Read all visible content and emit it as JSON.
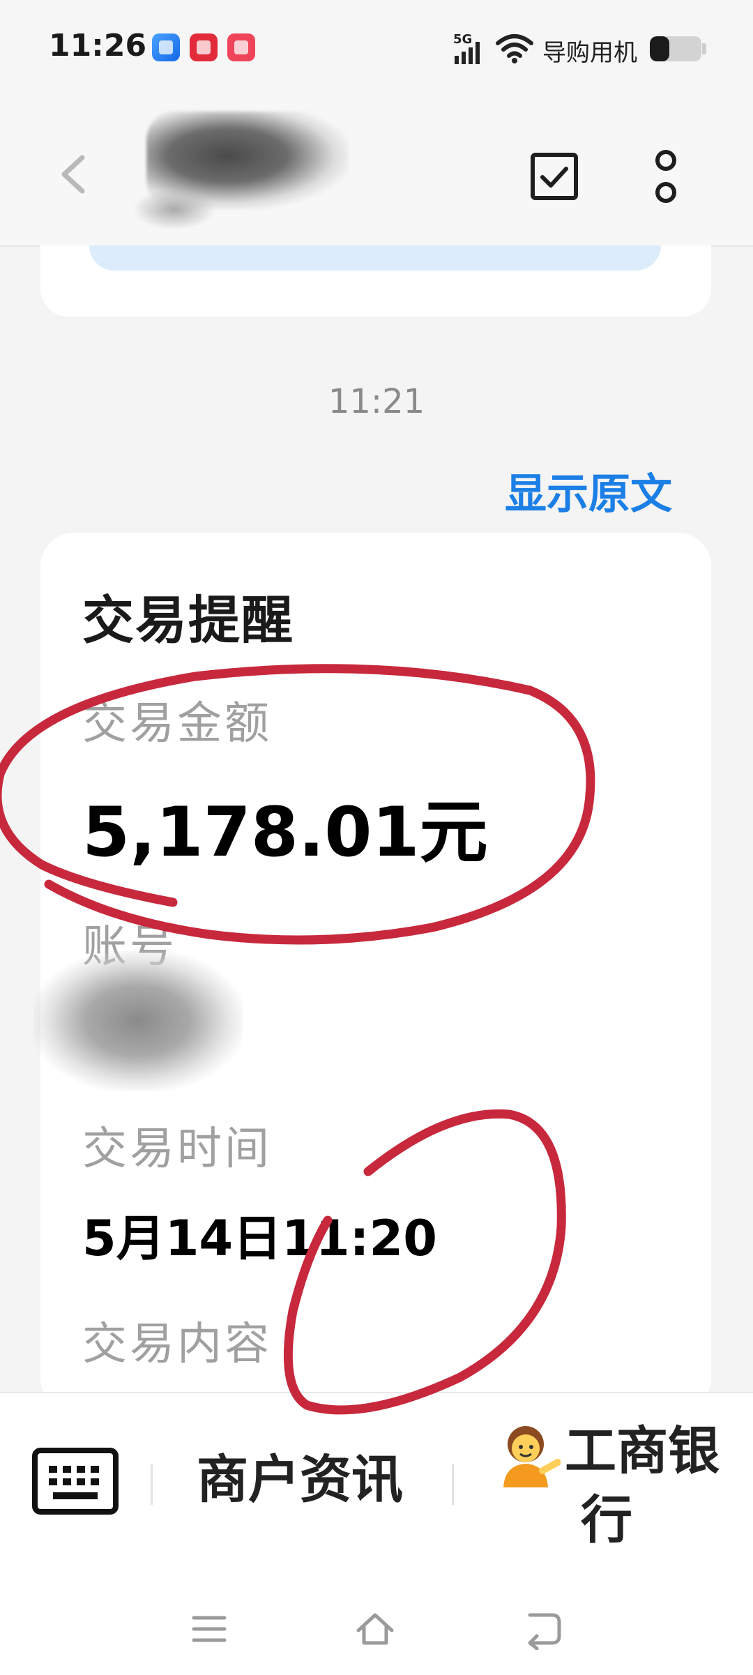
{
  "status_bar": {
    "time": "11:26",
    "network": "5G",
    "carrier_label": "导购用机",
    "battery_level": 0.38,
    "app_icons": [
      "blue-app-icon",
      "red-app-icon",
      "pink-app-icon"
    ]
  },
  "header": {
    "back_icon": "chevron-left-icon",
    "actions": [
      "checkbox-icon",
      "more-vertical-icon"
    ]
  },
  "thread": {
    "timestamp": "11:21",
    "show_original": "显示原文"
  },
  "card": {
    "title": "交易提醒",
    "amount_label": "交易金额",
    "amount_value": "5,178.01元",
    "account_label": "账号",
    "time_label": "交易时间",
    "time_value": "5月14日11:20",
    "content_label": "交易内容"
  },
  "bottom_bar": {
    "merchant_info": "商户资讯",
    "bank_name": "工商银行"
  },
  "nav": [
    "menu-icon",
    "home-icon",
    "back-icon"
  ],
  "colors": {
    "accent": "#1b7fe6",
    "annotation": "#c8283c",
    "background": "#f4f4f4"
  }
}
